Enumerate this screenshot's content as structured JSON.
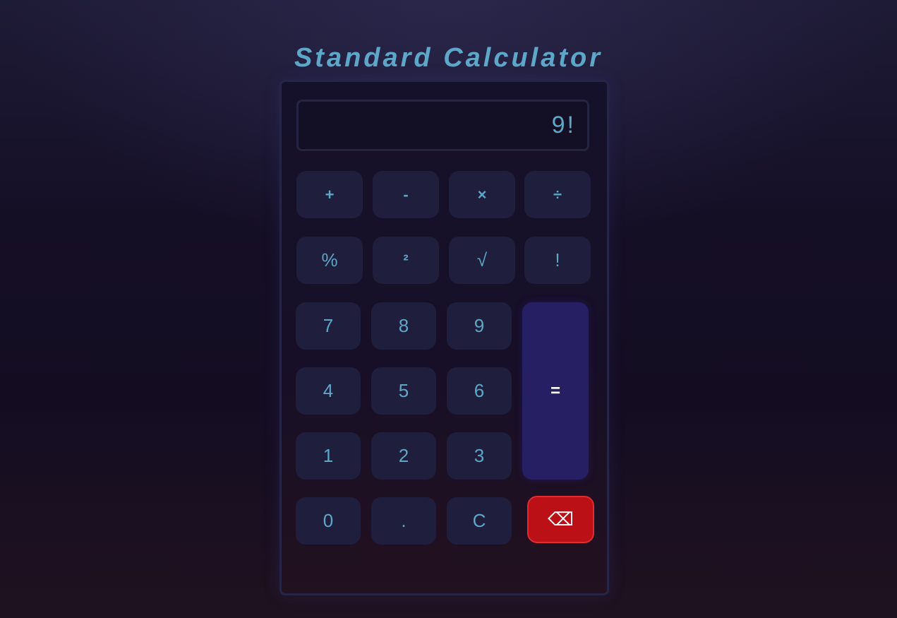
{
  "app": {
    "title": "Standard Calculator"
  },
  "display": {
    "value": "9!"
  },
  "buttons": {
    "plus": "+",
    "minus": "-",
    "multiply": "×",
    "divide": "÷",
    "percent": "%",
    "square": "²",
    "sqrt": "√",
    "factorial": "!",
    "seven": "7",
    "eight": "8",
    "nine": "9",
    "four": "4",
    "five": "5",
    "six": "6",
    "one": "1",
    "two": "2",
    "three": "3",
    "zero": "0",
    "decimal": ".",
    "clear": "C",
    "equals": "=",
    "backspace": "⌫"
  },
  "colors": {
    "accent": "#5ea7c9",
    "button_bg": "#1f1e3c",
    "equals_bg": "#271f63",
    "backspace_bg": "#bc1017"
  }
}
